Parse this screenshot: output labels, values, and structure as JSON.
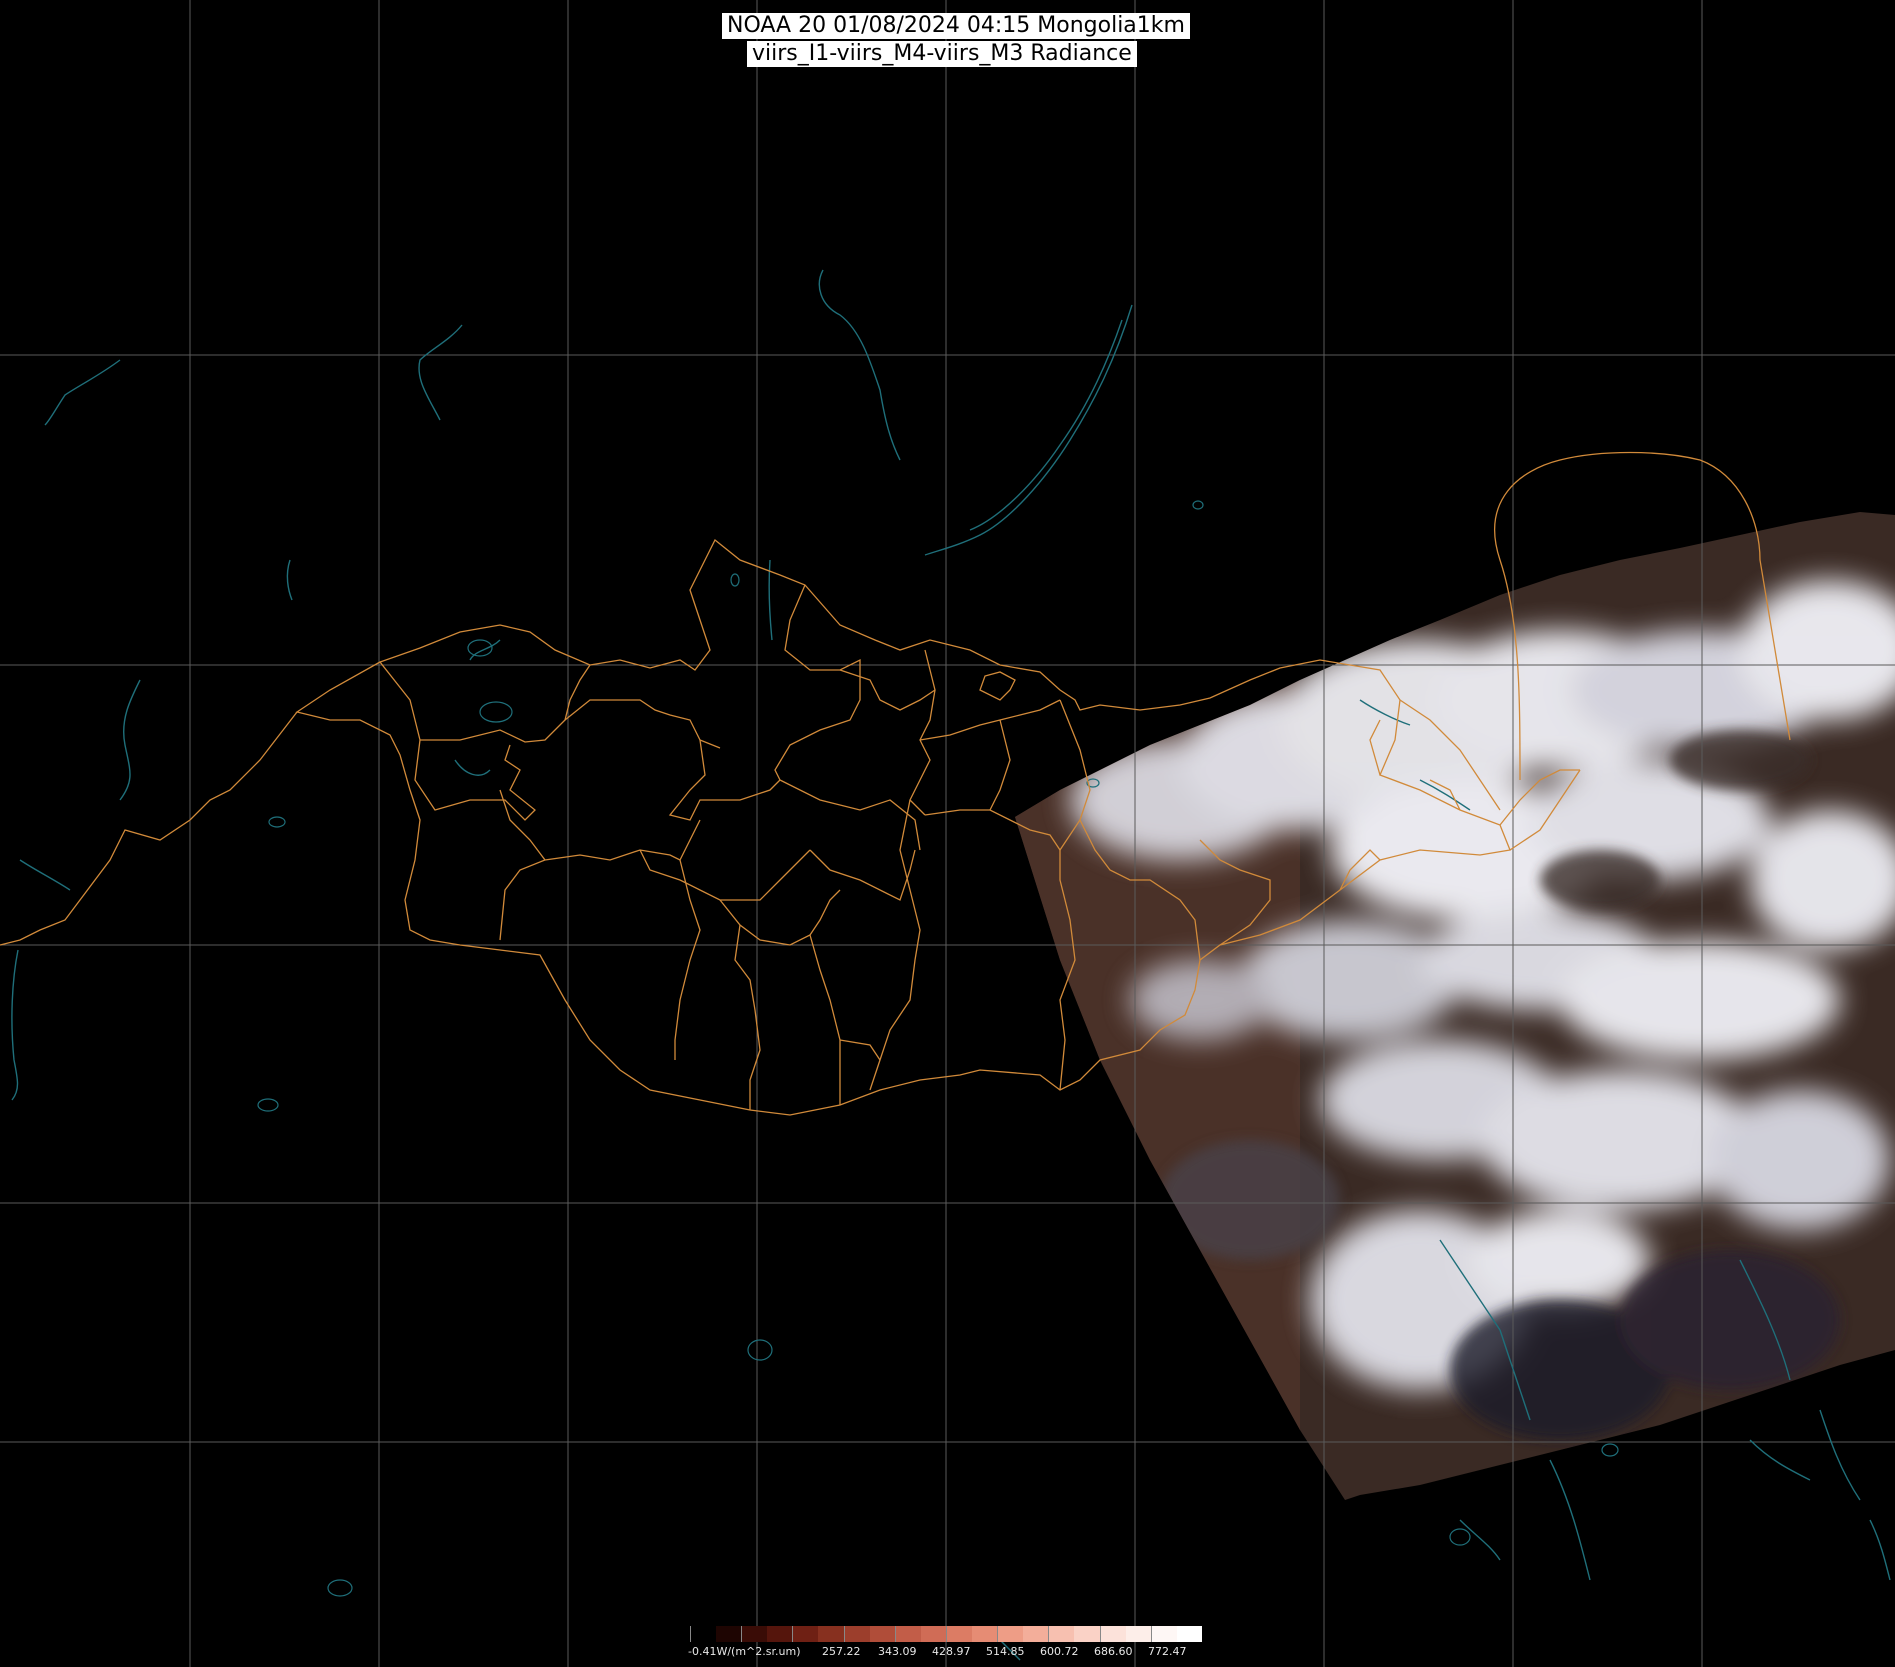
{
  "title": {
    "line1": "NOAA 20 01/08/2024 04:15 Mongolia1km",
    "line2": "viirs_I1-viirs_M4-viirs_M3 Radiance"
  },
  "colorbar": {
    "labels": [
      "-0.41W/(m^2.sr.um)",
      "257.22",
      "343.09",
      "428.97",
      "514.85",
      "600.72",
      "686.60",
      "772.47"
    ],
    "colors": [
      "#000000",
      "#1e0502",
      "#3a0c06",
      "#55150c",
      "#6f2014",
      "#87301f",
      "#9c3e2c",
      "#b04d39",
      "#c25d48",
      "#d06c56",
      "#dc7c64",
      "#e68c74",
      "#ee9d86",
      "#f3ae9a",
      "#f7c0b0",
      "#fad2c6",
      "#fce2da",
      "#fdeee9",
      "#fef7f5",
      "#ffffff"
    ]
  },
  "colors": {
    "background": "#000000",
    "grid": "#5a5a5a",
    "borders": "#d18a3a",
    "water": "#1f6f7a"
  }
}
